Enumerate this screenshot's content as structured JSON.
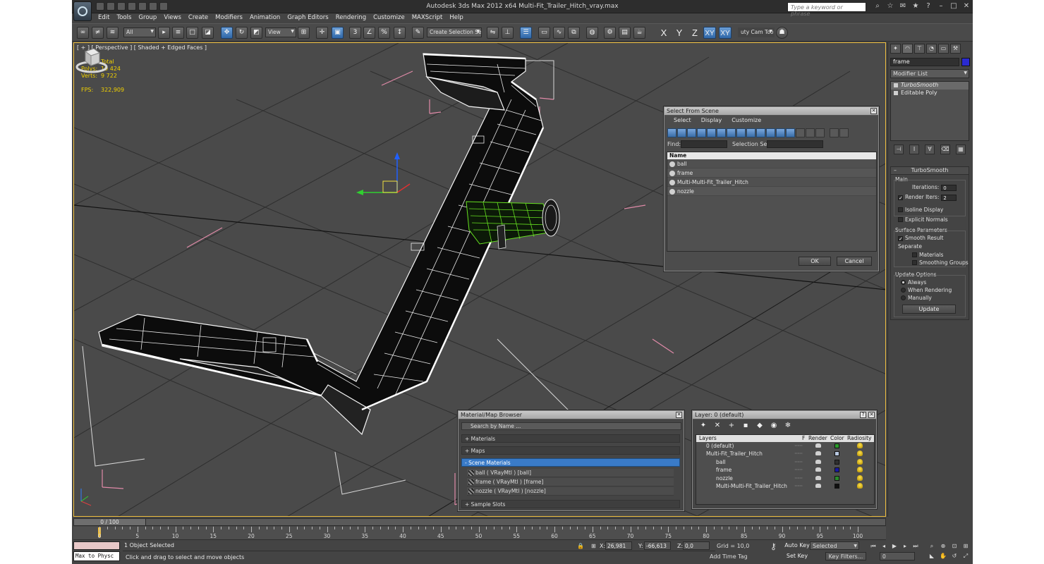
{
  "titlebar": {
    "title": "Autodesk 3ds Max  2012 x64      Multi-Fit_Trailer_Hitch_vray.max",
    "search_placeholder": "Type a keyword or phrase"
  },
  "menu": [
    "Edit",
    "Tools",
    "Group",
    "Views",
    "Create",
    "Modifiers",
    "Animation",
    "Graph Editors",
    "Rendering",
    "Customize",
    "MAXScript",
    "Help"
  ],
  "toolbar": {
    "filter": "All",
    "ref_coord": "View",
    "named_selection": "Create Selection Se",
    "axis_x": "X",
    "axis_y": "Y",
    "axis_z": "Z",
    "axis_xy": "XY",
    "axis_xy2": "XY",
    "cam_tool": "uty Cam Tool V"
  },
  "viewport": {
    "label": "[ + ] [ Perspective ] [ Shaded + Edged Faces ]",
    "stats_total": "Total",
    "polys_label": "Polys:",
    "polys": "19 424",
    "verts_label": "Verts:",
    "verts": "9 722",
    "fps_label": "FPS:",
    "fps": "322,909"
  },
  "command_panel": {
    "object_name": "frame",
    "object_color": "#2a2ad0",
    "modifier_list": "Modifier List",
    "stack": [
      "TurboSmooth",
      "Editable Poly"
    ],
    "rollout_title": "TurboSmooth",
    "main": "Main",
    "iterations_label": "Iterations:",
    "iterations": "0",
    "render_iters_label": "Render Iters:",
    "render_iters": "2",
    "isoline": "Isoline Display",
    "explicit_normals": "Explicit Normals",
    "surface_params": "Surface Parameters",
    "smooth_result": "Smooth Result",
    "separate": "Separate",
    "materials": "Materials",
    "smoothing_groups": "Smoothing Groups",
    "update_options": "Update Options",
    "always": "Always",
    "when_rendering": "When Rendering",
    "manually": "Manually",
    "update_button": "Update"
  },
  "select_from_scene": {
    "title": "Select From Scene",
    "menu": [
      "Select",
      "Display",
      "Customize"
    ],
    "find_label": "Find:",
    "selection_set_label": "Selection Set:",
    "column_name": "Name",
    "items": [
      "ball",
      "frame",
      "Multi-Multi-Fit_Trailer_Hitch",
      "nozzle"
    ],
    "ok": "OK",
    "cancel": "Cancel"
  },
  "material_browser": {
    "title": "Material/Map Browser",
    "search": "Search by Name ...",
    "sections": [
      "+ Materials",
      "+ Maps",
      "- Scene Materials",
      "+ Sample Slots"
    ],
    "scene_materials": [
      "ball  ( VRayMtl )  [ball]",
      "frame  ( VRayMtl )  [frame]",
      "nozzle  ( VRayMtl )  [nozzle]"
    ]
  },
  "layer_dialog": {
    "title": "Layer: 0 (default)",
    "help": "?",
    "columns": [
      "Layers",
      "F",
      "Render",
      "Color",
      "Radiosity"
    ],
    "rows": [
      {
        "name": "0 (default)",
        "color": "#2a9a2a"
      },
      {
        "name": "Multi-Fit_Trailer_Hitch",
        "color": "#b8c8e0"
      },
      {
        "name": "ball",
        "color": "#303030"
      },
      {
        "name": "frame",
        "color": "#1a1aa0"
      },
      {
        "name": "nozzle",
        "color": "#2a8a2a"
      },
      {
        "name": "Multi-Multi-Fit_Trailer_Hitch",
        "color": "#101010"
      }
    ]
  },
  "timeline": {
    "frame_counter": "0 / 100",
    "ticks": [
      "0",
      "5",
      "10",
      "15",
      "20",
      "25",
      "30",
      "35",
      "40",
      "45",
      "50",
      "55",
      "60",
      "65",
      "70",
      "75",
      "80",
      "85",
      "90",
      "95",
      "100"
    ]
  },
  "status": {
    "maxscript_text": "Max to Physc",
    "selection": "1 Object Selected",
    "prompt": "Click and drag to select and move objects",
    "x_label": "X:",
    "x": "26,981",
    "y_label": "Y:",
    "y": "-66,613",
    "z_label": "Z:",
    "z": "0,0",
    "grid": "Grid = 10,0",
    "add_time_tag": "Add Time Tag",
    "auto_key": "Auto Key",
    "set_key": "Set Key",
    "selected": "Selected",
    "key_filters": "Key Filters...",
    "frame": "0"
  }
}
